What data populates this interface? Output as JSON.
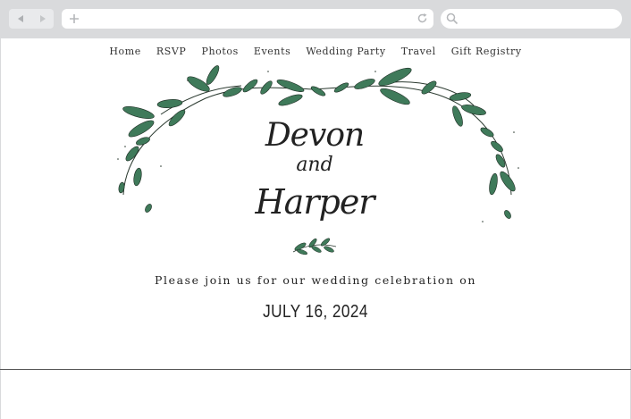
{
  "browser": {
    "back_icon": "back-arrow-icon",
    "forward_icon": "forward-arrow-icon",
    "new_tab_icon": "plus-icon",
    "reload_icon": "reload-icon",
    "search_icon": "search-icon",
    "url": "",
    "search_placeholder": ""
  },
  "nav": {
    "items": [
      {
        "label": "Home"
      },
      {
        "label": "RSVP"
      },
      {
        "label": "Photos"
      },
      {
        "label": "Events"
      },
      {
        "label": "Wedding Party"
      },
      {
        "label": "Travel"
      },
      {
        "label": "Gift Registry"
      }
    ]
  },
  "couple": {
    "name1": "Devon",
    "and": "and",
    "name2": "Harper"
  },
  "invitation": {
    "text": "Please join us for our wedding celebration on",
    "date": "JULY 16, 2024"
  },
  "colors": {
    "chrome": "#d9dadc",
    "leaf": "#3f7a5a",
    "text": "#222222"
  }
}
